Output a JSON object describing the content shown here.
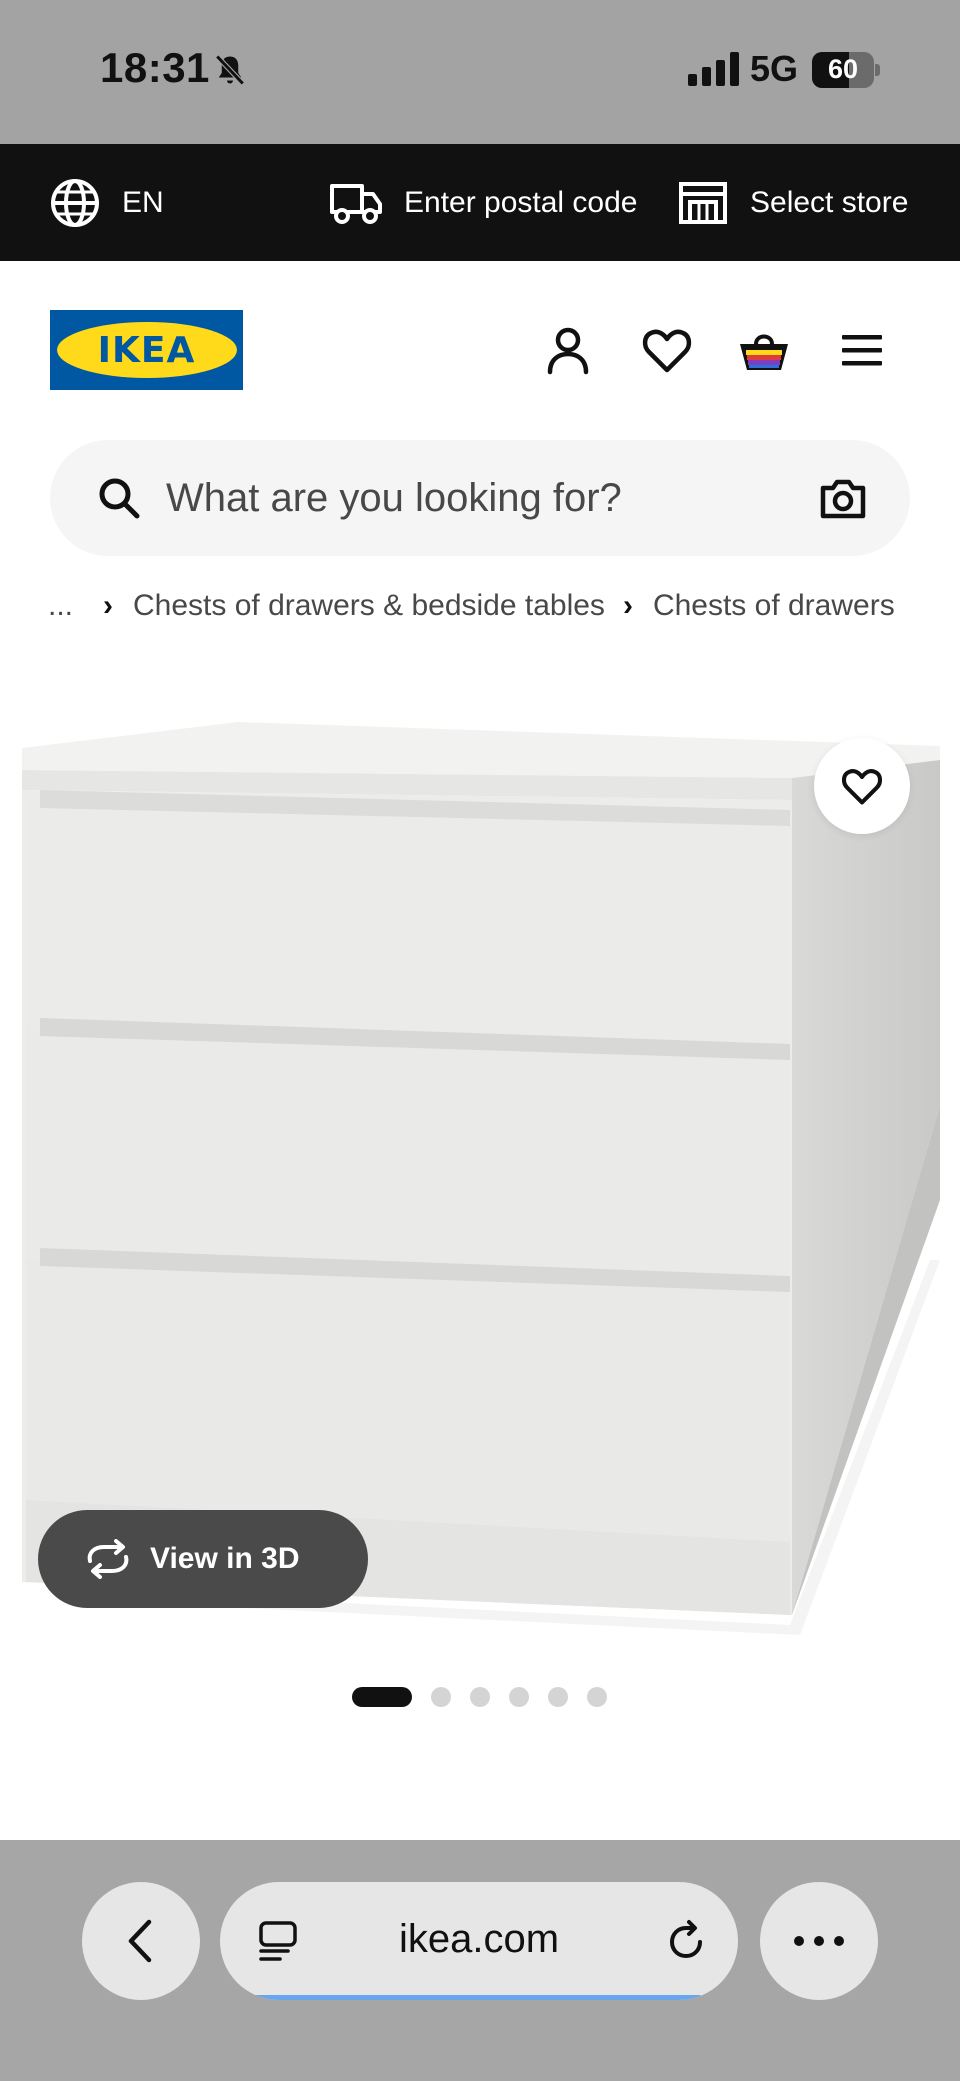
{
  "status_bar": {
    "time": "18:31",
    "network": "5G",
    "battery": "60",
    "battery_level": 0.6
  },
  "topbar": {
    "language": "EN",
    "postal": "Enter postal code",
    "store": "Select store"
  },
  "header": {
    "logo_text": "IKEA",
    "icons": [
      "profile-icon",
      "heart-icon",
      "basket-icon",
      "menu-icon"
    ]
  },
  "search": {
    "placeholder": "What are you looking for?"
  },
  "breadcrumb": {
    "ellipsis": "...",
    "items": [
      "Chests of drawers & bedside tables",
      "Chests of drawers"
    ]
  },
  "product": {
    "view3d_label": "View in 3D",
    "image_count": 6,
    "active_image": 1
  },
  "browser": {
    "url": "ikea.com"
  },
  "colors": {
    "ikea_blue": "#0058a3",
    "ikea_yellow": "#ffda1a",
    "topbar": "#111111"
  }
}
